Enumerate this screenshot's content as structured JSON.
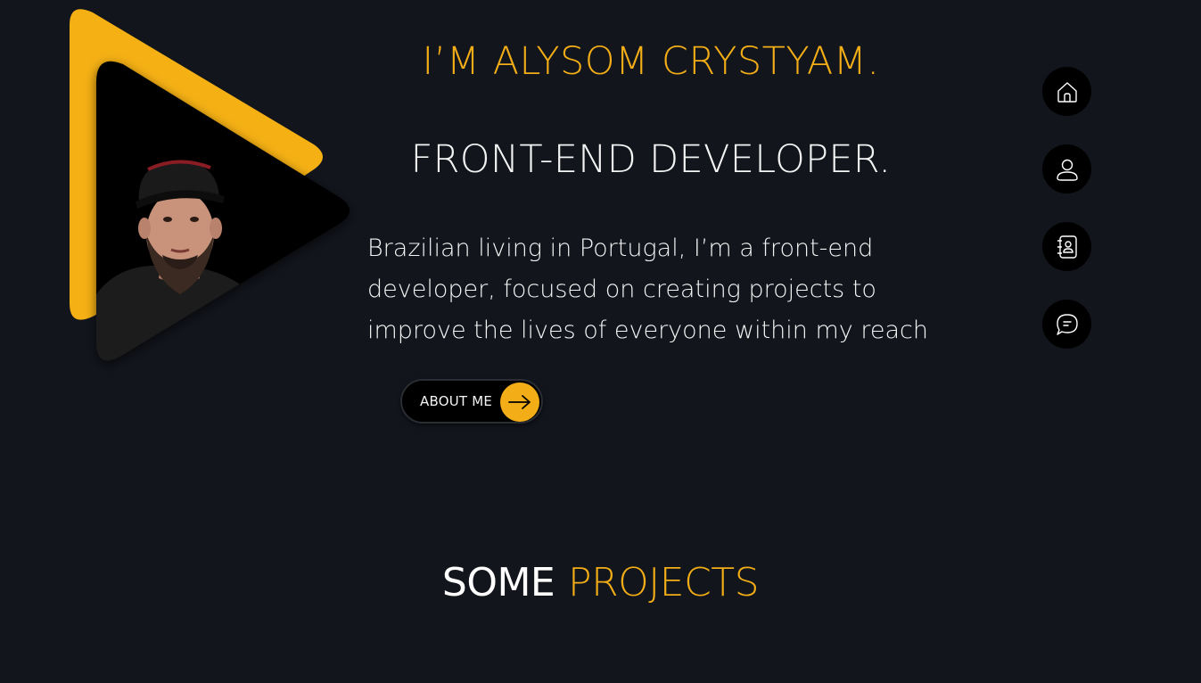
{
  "hero": {
    "greeting": "I’M ALYSOM CRYSTYAM.",
    "role": "FRONT-END DEVELOPER.",
    "bio": "Brazilian living in Portugal, I’m a front-end developer, focused on creating projects to improve the lives of everyone within my reach",
    "about_button_label": "ABOUT ME",
    "avatar_icon": "profile-photo",
    "arrow_icon": "arrow-right-icon"
  },
  "side_nav": {
    "items": [
      {
        "name": "home",
        "icon": "home-icon"
      },
      {
        "name": "about",
        "icon": "user-icon"
      },
      {
        "name": "contacts",
        "icon": "contact-book-icon"
      },
      {
        "name": "messages",
        "icon": "chat-icon"
      }
    ]
  },
  "projects": {
    "title_part1": "SOME",
    "title_part2": "PROJECTS"
  },
  "colors": {
    "background": "#12151c",
    "accent": "#f2ad17",
    "text": "#f4f4f4",
    "nav_bg": "#000000"
  }
}
